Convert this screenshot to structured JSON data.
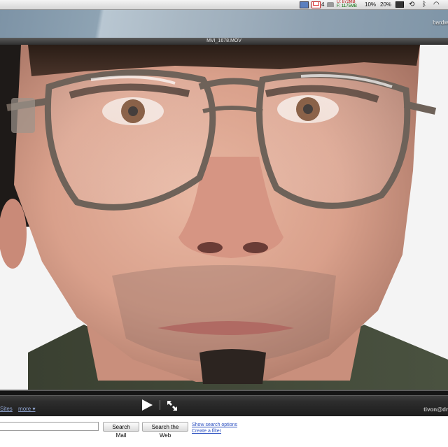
{
  "menubar": {
    "mail_count": "4",
    "mem_used": "U: 872MB",
    "mem_free": "F: 1175MB",
    "cpu1": "10%",
    "cpu2": "20%"
  },
  "desktop": {
    "label": "hardw"
  },
  "player": {
    "title": "MVI_1678.MOV",
    "links": [
      "Sites",
      "more ▾"
    ]
  },
  "account": {
    "user": "tivon@dr"
  },
  "search": {
    "input_value": "",
    "search_mail_label": "Search Mail",
    "search_web_label": "Search the Web",
    "show_options_label": "Show search options",
    "create_filter_label": "Create a filter"
  },
  "icons": {
    "play": "play-icon",
    "fullscreen": "fullscreen-icon"
  }
}
